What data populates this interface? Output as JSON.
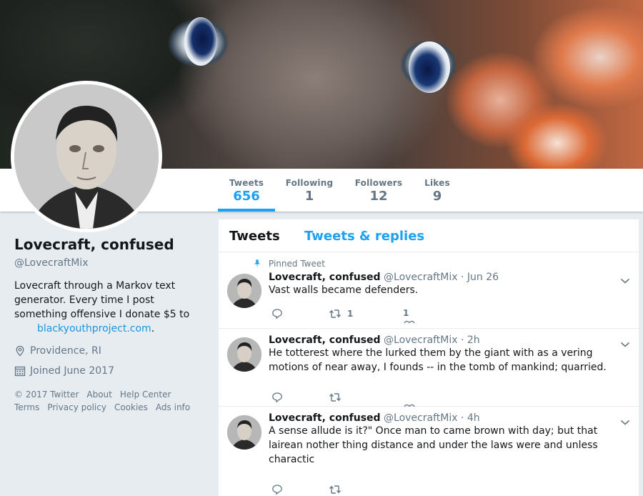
{
  "nav": {
    "tweets": {
      "label": "Tweets",
      "value": "656"
    },
    "following": {
      "label": "Following",
      "value": "1"
    },
    "followers": {
      "label": "Followers",
      "value": "12"
    },
    "likes": {
      "label": "Likes",
      "value": "9"
    }
  },
  "profile": {
    "name": "Lovecraft, confused",
    "handle": "@LovecraftMix",
    "bio_text": "Lovecraft through a Markov text generator. Every time I post something offensive I donate $5 to",
    "bio_link": "blackyouthproject.com",
    "bio_end": ".",
    "location": "Providence, RI",
    "joined": "Joined June 2017"
  },
  "footer": {
    "copyright": "© 2017 Twitter",
    "about": "About",
    "help": "Help Center",
    "terms": "Terms",
    "privacy": "Privacy policy",
    "cookies": "Cookies",
    "ads": "Ads info"
  },
  "timeline": {
    "tab_tweets": "Tweets",
    "tab_replies": "Tweets & replies",
    "pinned_label": "Pinned Tweet",
    "tweets": [
      {
        "name": "Lovecraft, confused",
        "handle": "@LovecraftMix",
        "dot": "·",
        "time": "Jun 26",
        "text": "Vast walls became defenders.",
        "retweets": "1",
        "likes": "1"
      },
      {
        "name": "Lovecraft, confused",
        "handle": "@LovecraftMix",
        "dot": "·",
        "time": "2h",
        "text": "He totterest where the lurked them by the giant with as a vering motions of near away, I founds -- in the tomb of mankind; quarried.",
        "retweets": "",
        "likes": ""
      },
      {
        "name": "Lovecraft, confused",
        "handle": "@LovecraftMix",
        "dot": "·",
        "time": "4h",
        "text": "A sense allude is it?\" Once man to came brown with day; but that lairean nother thing distance and under the laws were and unless charactic",
        "retweets": "",
        "likes": ""
      }
    ]
  },
  "colors": {
    "accent": "#1da1f2",
    "link": "#1b95e0",
    "muted": "#657786",
    "background": "#e6ecf0"
  },
  "icons": [
    "pin-icon",
    "location-icon",
    "calendar-icon",
    "reply-icon",
    "retweet-icon",
    "heart-icon",
    "chevron-down-icon"
  ]
}
